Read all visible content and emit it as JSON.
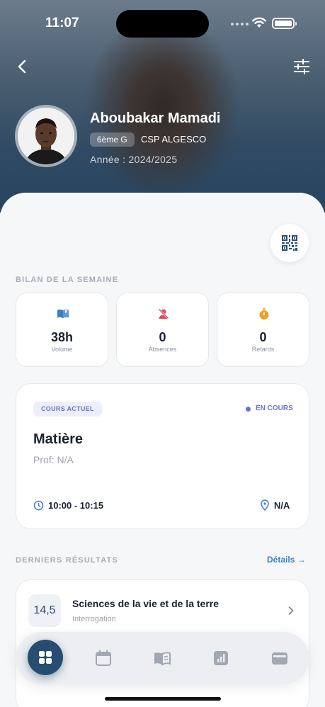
{
  "status_bar": {
    "time": "11:07"
  },
  "profile": {
    "name": "Aboubakar Mamadi",
    "class": "6ème G",
    "school": "CSP ALGESCO",
    "year": "Année : 2024/2025"
  },
  "weekly_summary": {
    "title": "BILAN DE LA SEMAINE",
    "stats": [
      {
        "icon": "book-open-icon",
        "value": "38h",
        "label": "Volume",
        "color": "#3b82c4"
      },
      {
        "icon": "user-absent-icon",
        "value": "0",
        "label": "Absences",
        "color": "#e2485b"
      },
      {
        "icon": "stopwatch-icon",
        "value": "0",
        "label": "Retards",
        "color": "#f0a020"
      }
    ]
  },
  "current_course": {
    "badge": "COURS ACTUEL",
    "status": "EN COURS",
    "subject": "Matière",
    "teacher": "Prof: N/A",
    "time": "10:00 - 10:15",
    "room": "N/A"
  },
  "latest_results": {
    "title": "DERNIERS RÉSULTATS",
    "details_link": "Détails →",
    "items": [
      {
        "grade": "14,5",
        "subject": "Sciences de la vie et de la terre",
        "type": "Interrogation"
      }
    ]
  },
  "tab_bar": {
    "items": [
      {
        "icon": "grid-icon",
        "active": true
      },
      {
        "icon": "calendar-icon",
        "active": false
      },
      {
        "icon": "book-icon",
        "active": false
      },
      {
        "icon": "chart-icon",
        "active": false
      },
      {
        "icon": "wallet-icon",
        "active": false
      }
    ]
  },
  "colors": {
    "accent": "#274d72",
    "course_accent": "#6b74c9",
    "link": "#3d7fc9"
  }
}
